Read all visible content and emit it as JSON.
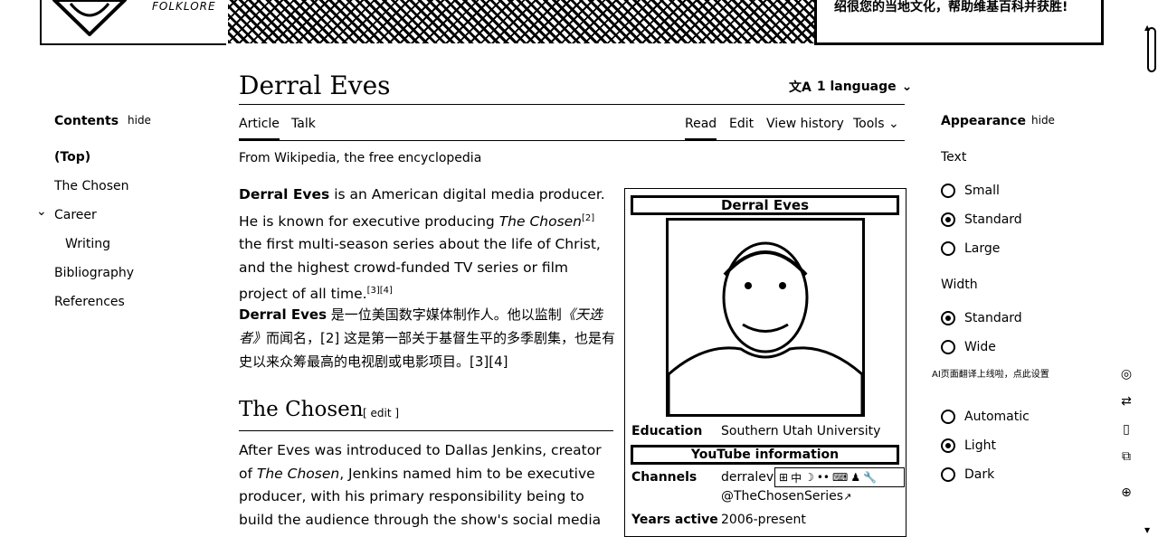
{
  "banner": {
    "folklore": "FOLKLORE",
    "text": "绍很您的当地文化，帮助维基百科并获胜!"
  },
  "page": {
    "title": "Derral Eves",
    "language_button": "1 language",
    "tagline": "From Wikipedia, the free encyclopedia"
  },
  "tabs": {
    "article": "Article",
    "talk": "Talk",
    "read": "Read",
    "edit": "Edit",
    "view_history": "View history",
    "tools": "Tools"
  },
  "toc": {
    "heading": "Contents",
    "hide": "hide",
    "items": [
      "(Top)",
      "The Chosen",
      "Career",
      "Writing",
      "Bibliography",
      "References"
    ]
  },
  "article": {
    "p1_bold": "Derral Eves",
    "p1_a": " is an American digital media producer. He is known for executive producing ",
    "p1_italic": "The Chosen",
    "p1_ref1": "[2]",
    "p1_b": " the first multi-season series about the life of Christ, and the highest crowd-funded TV series or film project of all time.",
    "p1_ref2": "[3][4]",
    "zh_bold": "Derral Eves",
    "zh_a": " 是一位美国数字媒体制作人。他以监制",
    "zh_italic": "《天选者》",
    "zh_b": "而闻名，[2] 这是第一部关于基督生平的多季剧集，也是有史以来众筹最高的电视剧或电影项目。[3][4]",
    "section_title": "The Chosen",
    "section_edit": "[ edit ]",
    "p2_a": "After Eves was introduced to Dallas Jenkins, creator of ",
    "p2_italic": "The Chosen",
    "p2_b": ", Jenkins named him to be executive producer, with his primary responsibility being to build the audience through the show's social media"
  },
  "infobox": {
    "title": "Derral Eves",
    "education_label": "Education",
    "education_value": "Southern Utah University",
    "youtube_heading": "YouTube information",
    "channels_label": "Channels",
    "channels_value1": "derraleves",
    "channels_value2": "@TheChosenSeries",
    "years_label": "Years active",
    "years_value": "2006-present",
    "toolbar_glyph": "中"
  },
  "appearance": {
    "heading": "Appearance",
    "hide": "hide",
    "text_label": "Text",
    "text_options": [
      "Small",
      "Standard",
      "Large"
    ],
    "text_selected": "Standard",
    "width_label": "Width",
    "width_options": [
      "Standard",
      "Wide"
    ],
    "width_selected": "Standard",
    "ai_note": "AI页面翻译上线啦，点此设置",
    "color_options": [
      "Automatic",
      "Light",
      "Dark"
    ],
    "color_selected": "Light"
  }
}
